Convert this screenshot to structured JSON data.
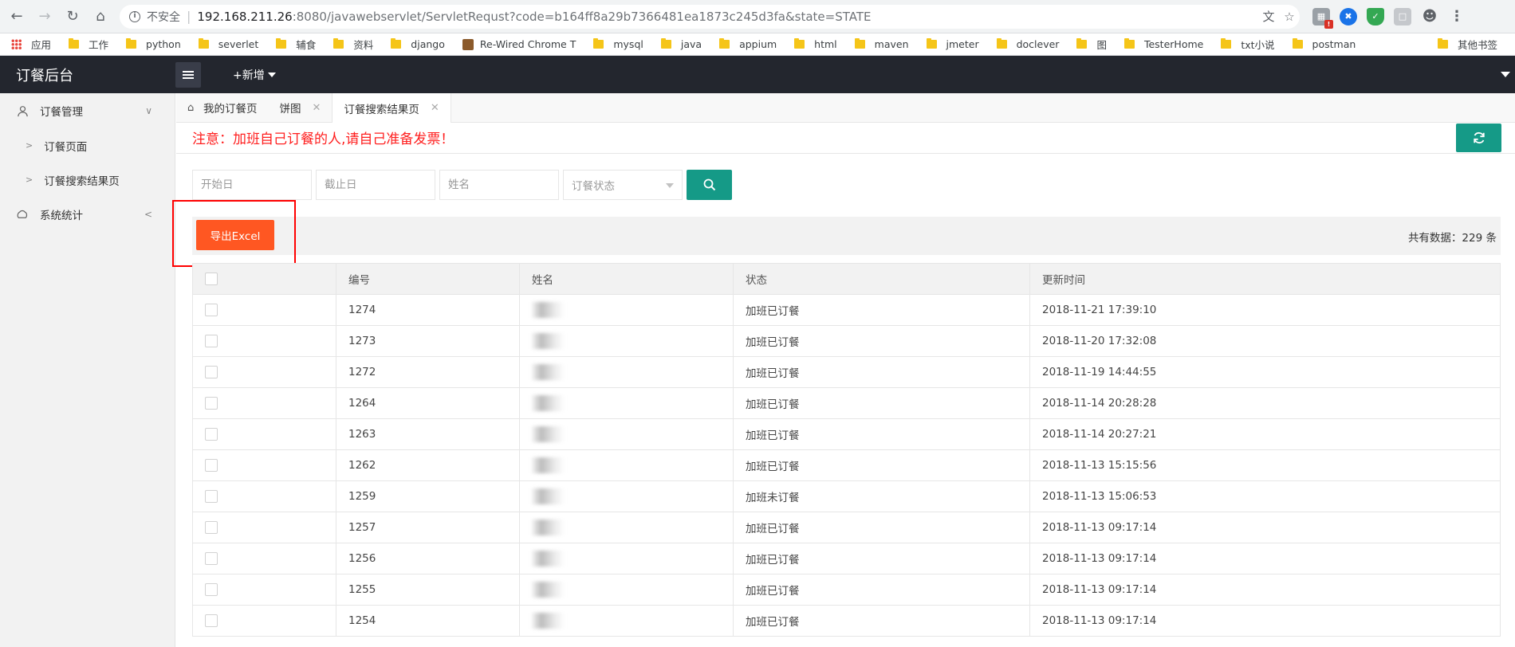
{
  "browser": {
    "insecure_label": "不安全",
    "url_host": "192.168.211.26",
    "url_rest": ":8080/javawebservlet/ServletRequst?code=b164ff8a29b7366481ea1873c245d3fa&state=STATE"
  },
  "bookmarks": {
    "apps_label": "应用",
    "items": [
      "工作",
      "python",
      "severlet",
      "辅食",
      "资料",
      "django",
      "Re-Wired Chrome T",
      "mysql",
      "java",
      "appium",
      "html",
      "maven",
      "jmeter",
      "doclever",
      "图",
      "TesterHome",
      "txt小说",
      "postman"
    ],
    "other_label": "其他书签"
  },
  "header": {
    "logo": "订餐后台",
    "add_new": "+新增"
  },
  "sidebar": {
    "groups": [
      {
        "label": "订餐管理",
        "expanded": true,
        "children": [
          "订餐页面",
          "订餐搜索结果页"
        ]
      },
      {
        "label": "系统统计",
        "expanded": false,
        "children": []
      }
    ]
  },
  "tabs": [
    {
      "label": "我的订餐页",
      "home": true,
      "active": false,
      "closable": false
    },
    {
      "label": "饼图",
      "home": false,
      "active": false,
      "closable": true
    },
    {
      "label": "订餐搜索结果页",
      "home": false,
      "active": true,
      "closable": true
    }
  ],
  "notice": "注意：加班自己订餐的人,请自己准备发票！",
  "search": {
    "start_placeholder": "开始日",
    "end_placeholder": "截止日",
    "name_placeholder": "姓名",
    "status_placeholder": "订餐状态"
  },
  "toolbar": {
    "export_label": "导出Excel",
    "total_label": "共有数据：229 条"
  },
  "table": {
    "columns": [
      "",
      "编号",
      "姓名",
      "状态",
      "更新时间"
    ],
    "rows": [
      {
        "id": "1274",
        "status": "加班已订餐",
        "time": "2018-11-21 17:39:10"
      },
      {
        "id": "1273",
        "status": "加班已订餐",
        "time": "2018-11-20 17:32:08"
      },
      {
        "id": "1272",
        "status": "加班已订餐",
        "time": "2018-11-19 14:44:55"
      },
      {
        "id": "1264",
        "status": "加班已订餐",
        "time": "2018-11-14 20:28:28"
      },
      {
        "id": "1263",
        "status": "加班已订餐",
        "time": "2018-11-14 20:27:21"
      },
      {
        "id": "1262",
        "status": "加班已订餐",
        "time": "2018-11-13 15:15:56"
      },
      {
        "id": "1259",
        "status": "加班未订餐",
        "time": "2018-11-13 15:06:53"
      },
      {
        "id": "1257",
        "status": "加班已订餐",
        "time": "2018-11-13 09:17:14"
      },
      {
        "id": "1256",
        "status": "加班已订餐",
        "time": "2018-11-13 09:17:14"
      },
      {
        "id": "1255",
        "status": "加班已订餐",
        "time": "2018-11-13 09:17:14"
      },
      {
        "id": "1254",
        "status": "加班已订餐",
        "time": "2018-11-13 09:17:14"
      }
    ]
  },
  "colors": {
    "header_bg": "#23262e",
    "accent_teal": "#159a87",
    "export_orange": "#ff5722",
    "notice_red": "#ff1e1e",
    "annotation_red": "#ff0000"
  }
}
